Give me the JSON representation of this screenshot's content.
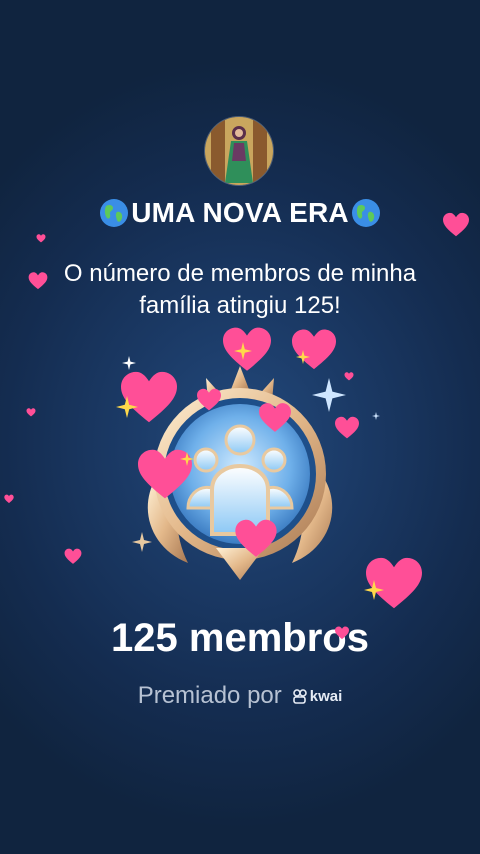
{
  "header": {
    "title": "UMA NOVA ERA",
    "title_icon": "globe-americas-icon"
  },
  "message": {
    "text": "O número de membros de minha família atingiu 125!"
  },
  "badge": {
    "icon": "family-members-badge-icon"
  },
  "milestone": {
    "label": "125 membros"
  },
  "footer": {
    "awarded_label": "Premiado por",
    "brand": "kwai",
    "brand_icon": "kwai-logo-icon"
  },
  "decorations": {
    "heart_color": "#ff4f97",
    "sparkle_color": "#ffd94a",
    "background_color": "#142c50"
  }
}
